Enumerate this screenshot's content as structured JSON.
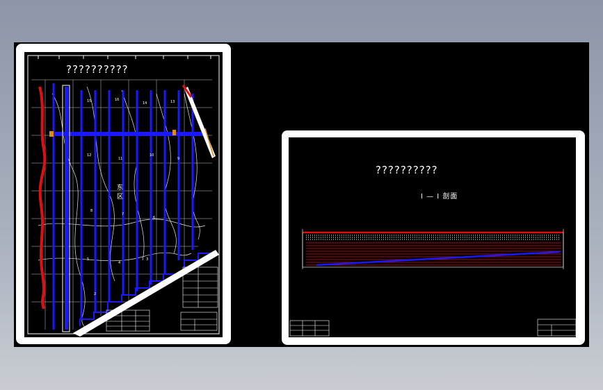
{
  "drawing": {
    "sheet1_title": "??????????",
    "sheet1_zone_label": "东区",
    "sheet2_title": "??????????",
    "sheet2_section_label": "I — I 剖面"
  },
  "colors": {
    "background_top": "#8c96a8",
    "background_bottom": "#c9ccd2",
    "viewport": "#000000",
    "sheet": "#ffffff",
    "pipe_blue": "#1a1aff",
    "line_red": "#e01010",
    "contour_white": "#ffffff",
    "accent_orange": "#e08a10"
  },
  "icons": [
    "drawing-sheet-icon"
  ]
}
